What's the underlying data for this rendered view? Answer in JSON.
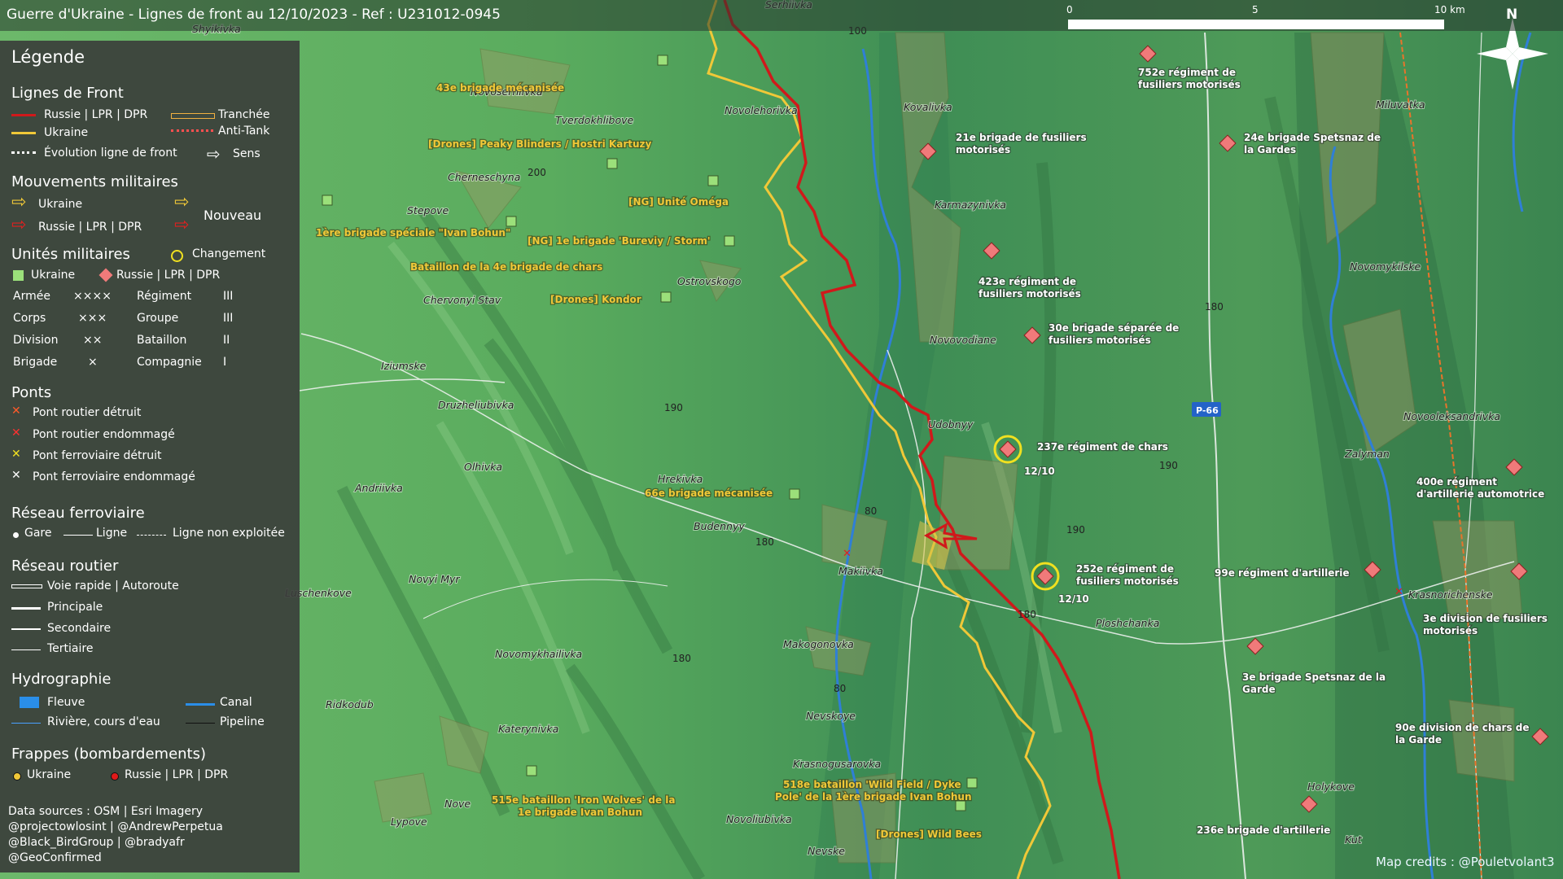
{
  "title": "Guerre d'Ukraine - Lignes de front au 12/10/2023 - Ref : U231012-0945",
  "scale": {
    "labels": [
      "0",
      "5",
      "10 km"
    ]
  },
  "north": "N",
  "credit": "Map credits : @Pouletvolant3",
  "colors": {
    "russia": "#d0191b",
    "ukraine": "#f0c838",
    "land": "#4f9a55",
    "water": "#2f7fd6",
    "ukraine_unit": "#9be07a",
    "russia_unit": "#f07a7a"
  },
  "legend": {
    "title": "Légende",
    "front": {
      "heading": "Lignes de Front",
      "russia": "Russie | LPR | DPR",
      "ukraine": "Ukraine",
      "trench": "Tranchée",
      "antitank": "Anti-Tank",
      "evolution": "Évolution ligne de front",
      "sens": "Sens"
    },
    "movements": {
      "heading": "Mouvements militaires",
      "ukraine": "Ukraine",
      "russia": "Russie | LPR | DPR",
      "new": "Nouveau"
    },
    "units": {
      "heading": "Unités militaires",
      "change": "Changement",
      "ukraine": "Ukraine",
      "russia": "Russie | LPR | DPR",
      "rows": [
        {
          "a": "Armée",
          "as": "×××× ",
          "b": "Régiment",
          "bs": "III"
        },
        {
          "a": "Corps",
          "as": "×××",
          "b": "Groupe",
          "bs": "III"
        },
        {
          "a": "Division",
          "as": "××",
          "b": "Bataillon",
          "bs": "II"
        },
        {
          "a": "Brigade",
          "as": "×",
          "b": "Compagnie",
          "bs": "I"
        }
      ]
    },
    "bridges": {
      "heading": "Ponts",
      "items": [
        "Pont routier détruit",
        "Pont routier endommagé",
        "Pont ferroviaire détruit",
        "Pont ferroviaire endommagé"
      ]
    },
    "rail": {
      "heading": "Réseau ferroviaire",
      "station": "Gare",
      "line": "Ligne",
      "unused": "Ligne non exploitée"
    },
    "road": {
      "heading": "Réseau routier",
      "items": [
        "Voie rapide | Autoroute",
        "Principale",
        "Secondaire",
        "Tertiaire"
      ]
    },
    "hydro": {
      "heading": "Hydrographie",
      "river": "Fleuve",
      "canal": "Canal",
      "stream": "Rivière, cours d'eau",
      "pipeline": "Pipeline"
    },
    "strikes": {
      "heading": "Frappes (bombardements)",
      "ukraine": "Ukraine",
      "russia": "Russie | LPR | DPR"
    },
    "sources": [
      "Data sources : OSM | Esri Imagery",
      "@projectowlosint | @AndrewPerpetua",
      "@Black_BirdGroup | @bradyafr",
      "@GeoConfirmed"
    ]
  },
  "places": [
    "Serhiivka",
    "Shyikivka",
    "Novoserhiivka",
    "Novolehorivka",
    "Tverdokhlibove",
    "Kovalivka",
    "Miluvatka",
    "Cherneschyna",
    "Karmazynivka",
    "Stepove",
    "Novomykilske",
    "Ostrovskogo",
    "Chervonyi Stav",
    "Novovodiane",
    "Iziumske",
    "Udobnyy",
    "Druzheliubivka",
    "Novooleksandrivka",
    "Olhivka",
    "Hrekivka",
    "Zalyman",
    "Andriivka",
    "Budennyy",
    "Makiivka",
    "Krasnorichenske",
    "Novyi Myr",
    "Luschenkove",
    "Ploshchanka",
    "Makogonovka",
    "Novomykhailivka",
    "Ridkodub",
    "Nevskoye",
    "Katerynivka",
    "Krasnogusarovka",
    "Holykove",
    "Nove",
    "Lypove",
    "Novoliubivka",
    "Nevske",
    "Kut"
  ],
  "road_label": "P-66",
  "elevations": [
    "100",
    "200",
    "190",
    "180",
    "190",
    "80",
    "180",
    "190",
    "180",
    "180",
    "80"
  ],
  "dates": [
    "12/10",
    "12/10"
  ],
  "units_ua": [
    "43e brigade mécanisée",
    "[Drones] Peaky Blinders / Hostri Kartuzy",
    "[NG] Unité Oméga",
    "1ère brigade spéciale \"Ivan Bohun\"",
    "[NG] 1e brigade 'Bureviy / Storm'",
    "Bataillon de la 4e brigade de chars",
    "[Drones] Kondor",
    "66e brigade mécanisée",
    "515e bataillon 'Iron Wolves' de la",
    "1e brigade Ivan Bohun",
    "518e bataillon 'Wild Field / Dyke",
    "Pole' de la 1ère brigade Ivan Bohun",
    "[Drones] Wild Bees"
  ],
  "units_ru": [
    "752e régiment de",
    "fusiliers motorisés",
    "21e brigade de fusiliers",
    "motorisés",
    "24e brigade Spetsnaz de",
    "la Gardes",
    "423e régiment de",
    "fusiliers motorisés",
    "30e brigade séparée de",
    "fusiliers motorisés",
    "237e régiment de chars",
    "252e régiment de",
    "fusiliers motorisés",
    "99e régiment d'artillerie",
    "400e régiment",
    "d'artillerie automotrice",
    "3e division de fusiliers",
    "motorisés",
    "3e brigade Spetsnaz de la",
    "Garde",
    "90e division de chars de",
    "la Garde",
    "236e brigade d'artillerie"
  ]
}
